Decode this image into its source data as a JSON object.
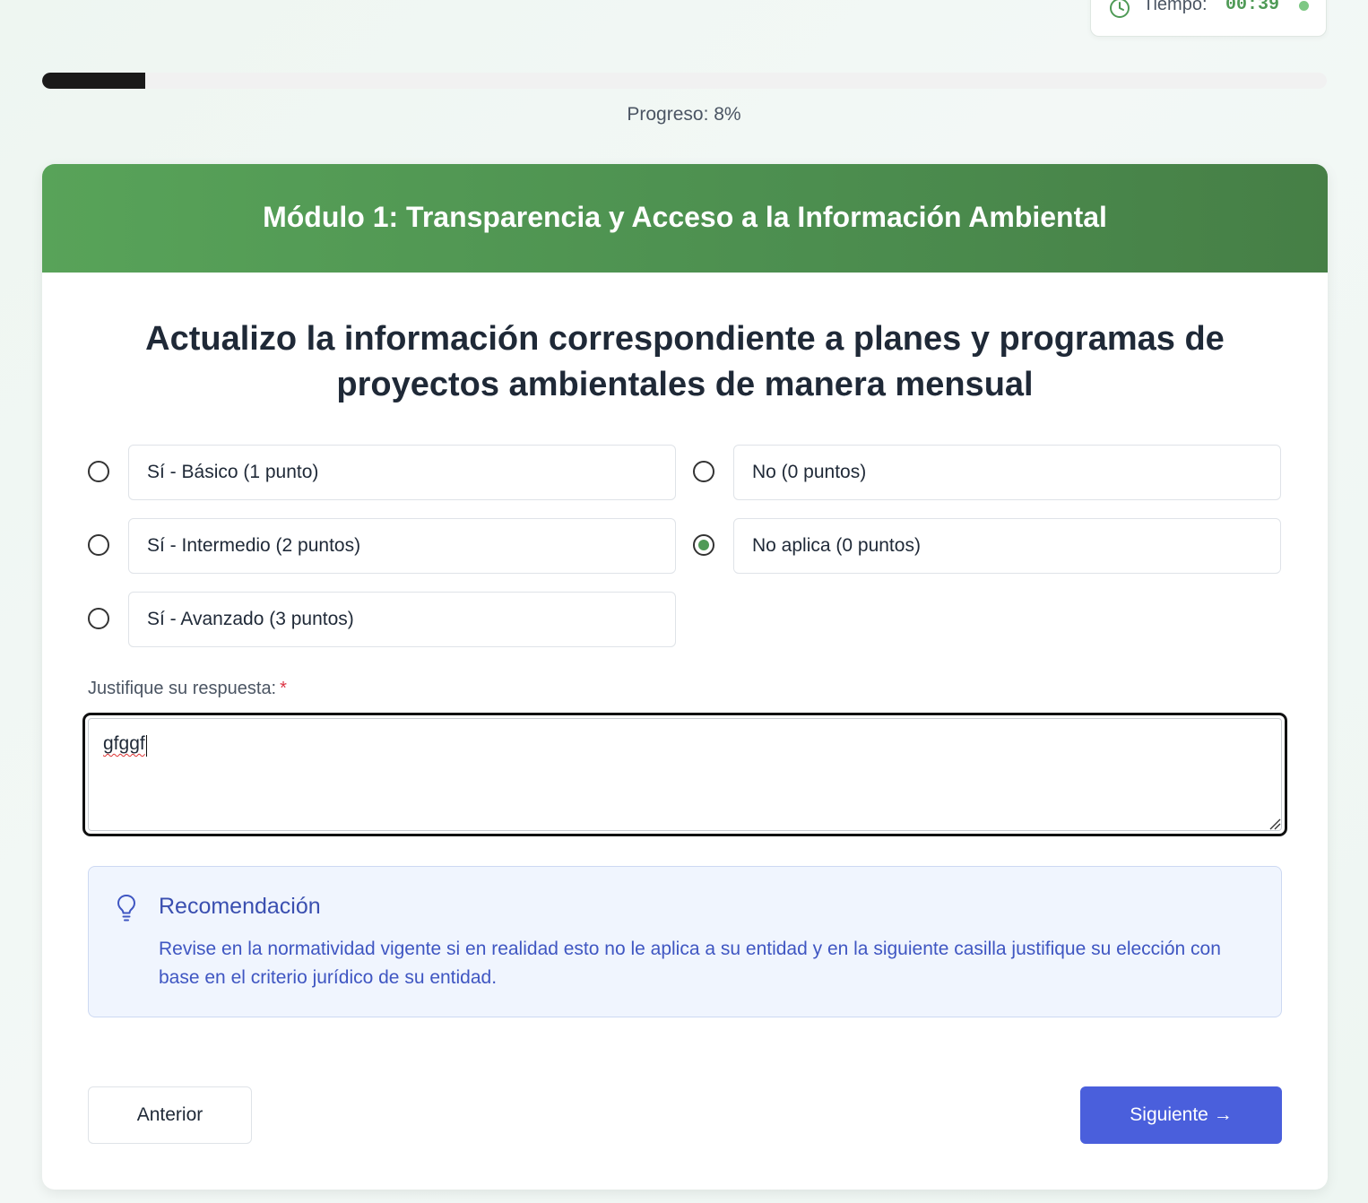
{
  "timer": {
    "label": "Tiempo:",
    "value": "00:39",
    "icon": "clock-icon",
    "status_color": "#7dc884"
  },
  "progress": {
    "label": "Progreso: 8%",
    "percent": 8
  },
  "module": {
    "title": "Módulo 1: Transparencia y Acceso a la Información Ambiental"
  },
  "question": {
    "text": "Actualizo la información correspondiente a planes y programas de proyectos ambientales de manera mensual"
  },
  "options": [
    {
      "label": "Sí - Básico (1 punto)",
      "checked": false
    },
    {
      "label": "No (0 puntos)",
      "checked": false
    },
    {
      "label": "Sí - Intermedio (2 puntos)",
      "checked": false
    },
    {
      "label": "No aplica (0 puntos)",
      "checked": true
    },
    {
      "label": "Sí - Avanzado (3 puntos)",
      "checked": false
    }
  ],
  "justification": {
    "label": "Justifique su respuesta:",
    "required_mark": "*",
    "value": "gfggf"
  },
  "recommendation": {
    "title": "Recomendación",
    "text": "Revise en la normatividad vigente si en realidad esto no le aplica a su entidad y en la siguiente casilla justifique su elección con base en el criterio jurídico de su entidad.",
    "icon": "lightbulb-icon"
  },
  "nav": {
    "prev_label": "Anterior",
    "next_label": "Siguiente →"
  },
  "colors": {
    "header_green": "#58a359",
    "accent_blue": "#4a5fdc",
    "progress_fill": "#1a1a1a",
    "radio_checked": "#4f9a56"
  }
}
